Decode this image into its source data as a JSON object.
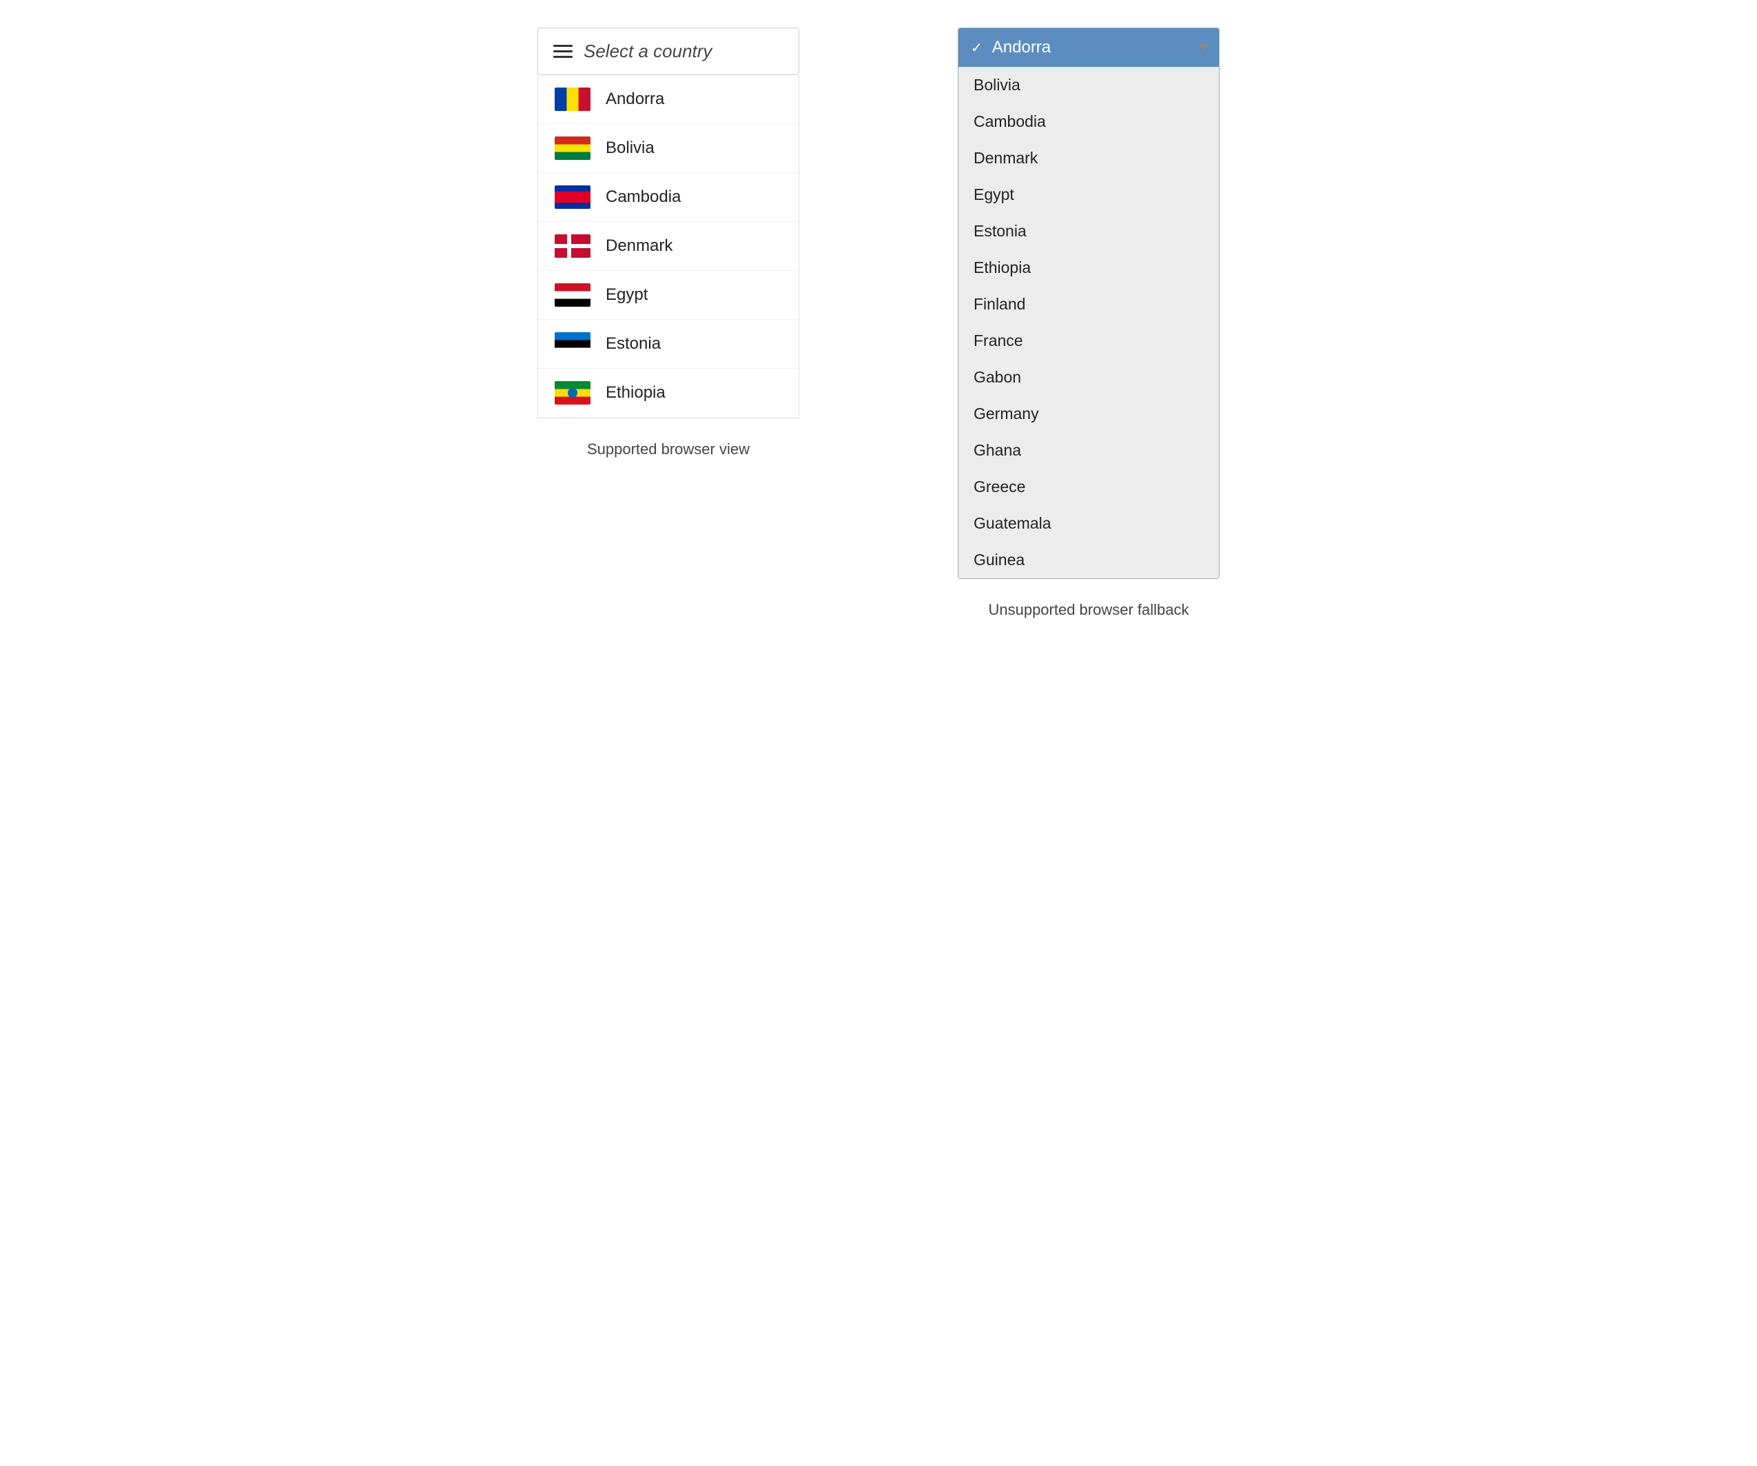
{
  "left": {
    "trigger": {
      "icon": "hamburger",
      "label": "Select a country"
    },
    "countries": [
      {
        "id": "andorra",
        "name": "Andorra",
        "flagClass": "flag-andorra"
      },
      {
        "id": "bolivia",
        "name": "Bolivia",
        "flagClass": "flag-bolivia"
      },
      {
        "id": "cambodia",
        "name": "Cambodia",
        "flagClass": "flag-cambodia"
      },
      {
        "id": "denmark",
        "name": "Denmark",
        "flagClass": "flag-denmark"
      },
      {
        "id": "egypt",
        "name": "Egypt",
        "flagClass": "flag-egypt"
      },
      {
        "id": "estonia",
        "name": "Estonia",
        "flagClass": "flag-estonia"
      },
      {
        "id": "ethiopia",
        "name": "Ethiopia",
        "flagClass": "flag-ethiopia"
      }
    ],
    "label": "Supported browser view"
  },
  "right": {
    "selected": "Andorra",
    "options": [
      "Bolivia",
      "Cambodia",
      "Denmark",
      "Egypt",
      "Estonia",
      "Ethiopia",
      "Finland",
      "France",
      "Gabon",
      "Germany",
      "Ghana",
      "Greece",
      "Guatemala",
      "Guinea"
    ],
    "label": "Unsupported browser fallback"
  }
}
